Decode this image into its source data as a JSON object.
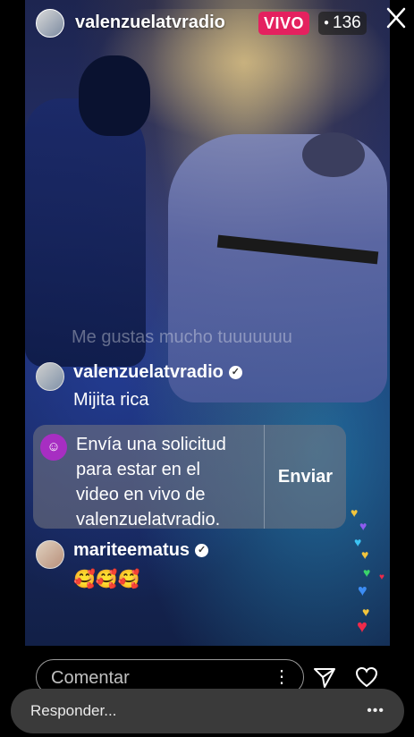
{
  "header": {
    "username": "valenzuelatvradio",
    "live_label": "VIVO",
    "viewer_count": "136"
  },
  "ghost_comment": "Me gustas mucho tuuuuuuu",
  "comments": [
    {
      "username": "valenzuelatvradio",
      "text": "Mijita rica"
    },
    {
      "username": "mariteematus",
      "text": "🥰🥰🥰"
    }
  ],
  "request": {
    "text_lines": [
      "Envía una solicitud",
      "para estar en el",
      "video en vivo de",
      "valenzuelatvradio."
    ],
    "button": "Enviar"
  },
  "footer": {
    "comment_placeholder": "Comentar",
    "reply_placeholder": "Responder...",
    "reply_more": "•••"
  }
}
